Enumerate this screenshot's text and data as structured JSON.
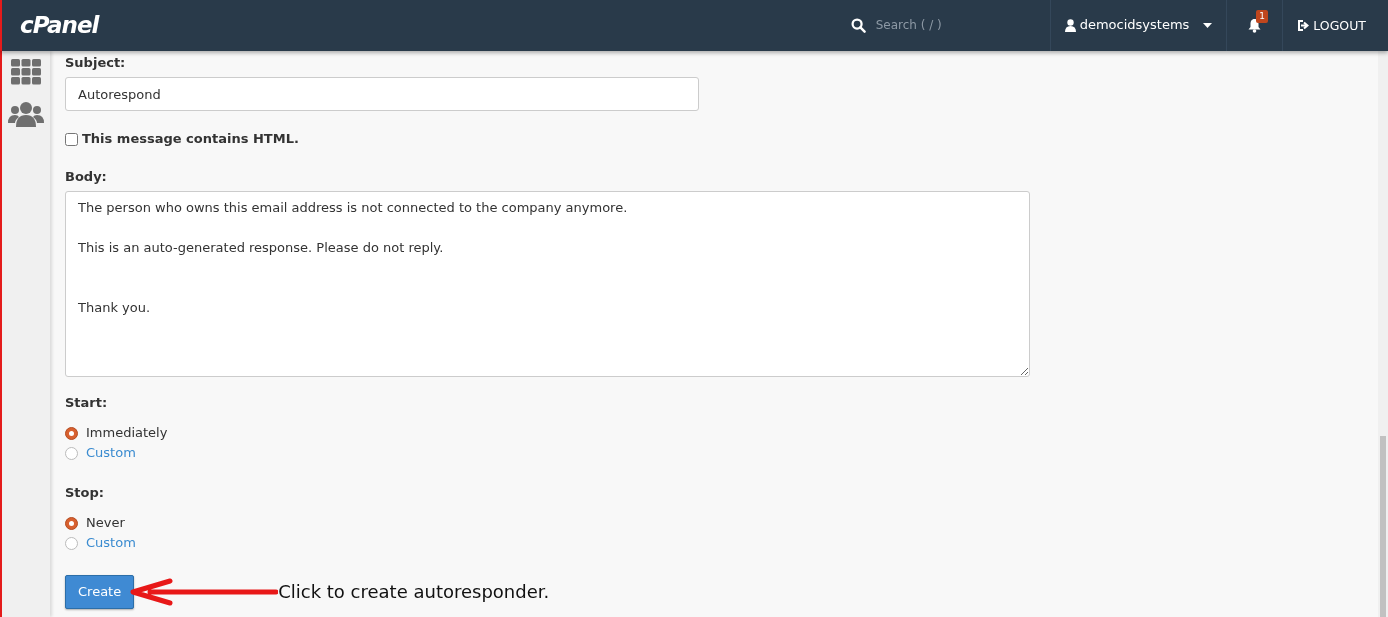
{
  "header": {
    "logo": "cPanel",
    "search": {
      "placeholder": "Search ( / )"
    },
    "user": "democidsystems",
    "notifications": "1",
    "logout": "LOGOUT"
  },
  "form": {
    "subject": {
      "label": "Subject:",
      "value": "Autorespond"
    },
    "html_option": {
      "label": "This message contains HTML.",
      "checked": false
    },
    "body": {
      "label": "Body:",
      "value": "The person who owns this email address is not connected to the company anymore.\n\nThis is an auto-generated response. Please do not reply.\n\n\nThank you."
    },
    "start": {
      "label": "Start:",
      "options": [
        {
          "label": "Immediately",
          "selected": true,
          "kind": "plain"
        },
        {
          "label": "Custom",
          "selected": false,
          "kind": "link"
        }
      ]
    },
    "stop": {
      "label": "Stop:",
      "options": [
        {
          "label": "Never",
          "selected": true,
          "kind": "plain"
        },
        {
          "label": "Custom",
          "selected": false,
          "kind": "link"
        }
      ]
    },
    "submit": "Create"
  },
  "annotation": "Click to create autoresponder."
}
